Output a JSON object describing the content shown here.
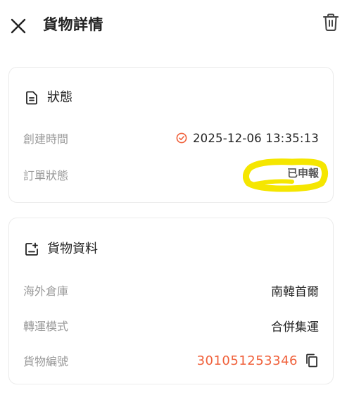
{
  "header": {
    "title": "貨物詳情"
  },
  "status_card": {
    "title": "狀態",
    "rows": [
      {
        "key": "創建時間",
        "value": "2025-12-06 13:35:13"
      },
      {
        "key": "訂單狀態",
        "value": "已申報"
      }
    ]
  },
  "cargo_card": {
    "title": "貨物資料",
    "rows": [
      {
        "key": "海外倉庫",
        "value": "南韓首爾"
      },
      {
        "key": "轉運模式",
        "value": "合併集運"
      },
      {
        "key": "貨物編號",
        "value": "301051253346"
      }
    ]
  },
  "colors": {
    "accent": "#f0603a",
    "highlight": "#f5e600",
    "label_gray": "#9a9a9a"
  },
  "icons": [
    "close-icon",
    "trash-icon",
    "document-icon",
    "check-circle-icon",
    "image-add-icon",
    "copy-icon"
  ]
}
